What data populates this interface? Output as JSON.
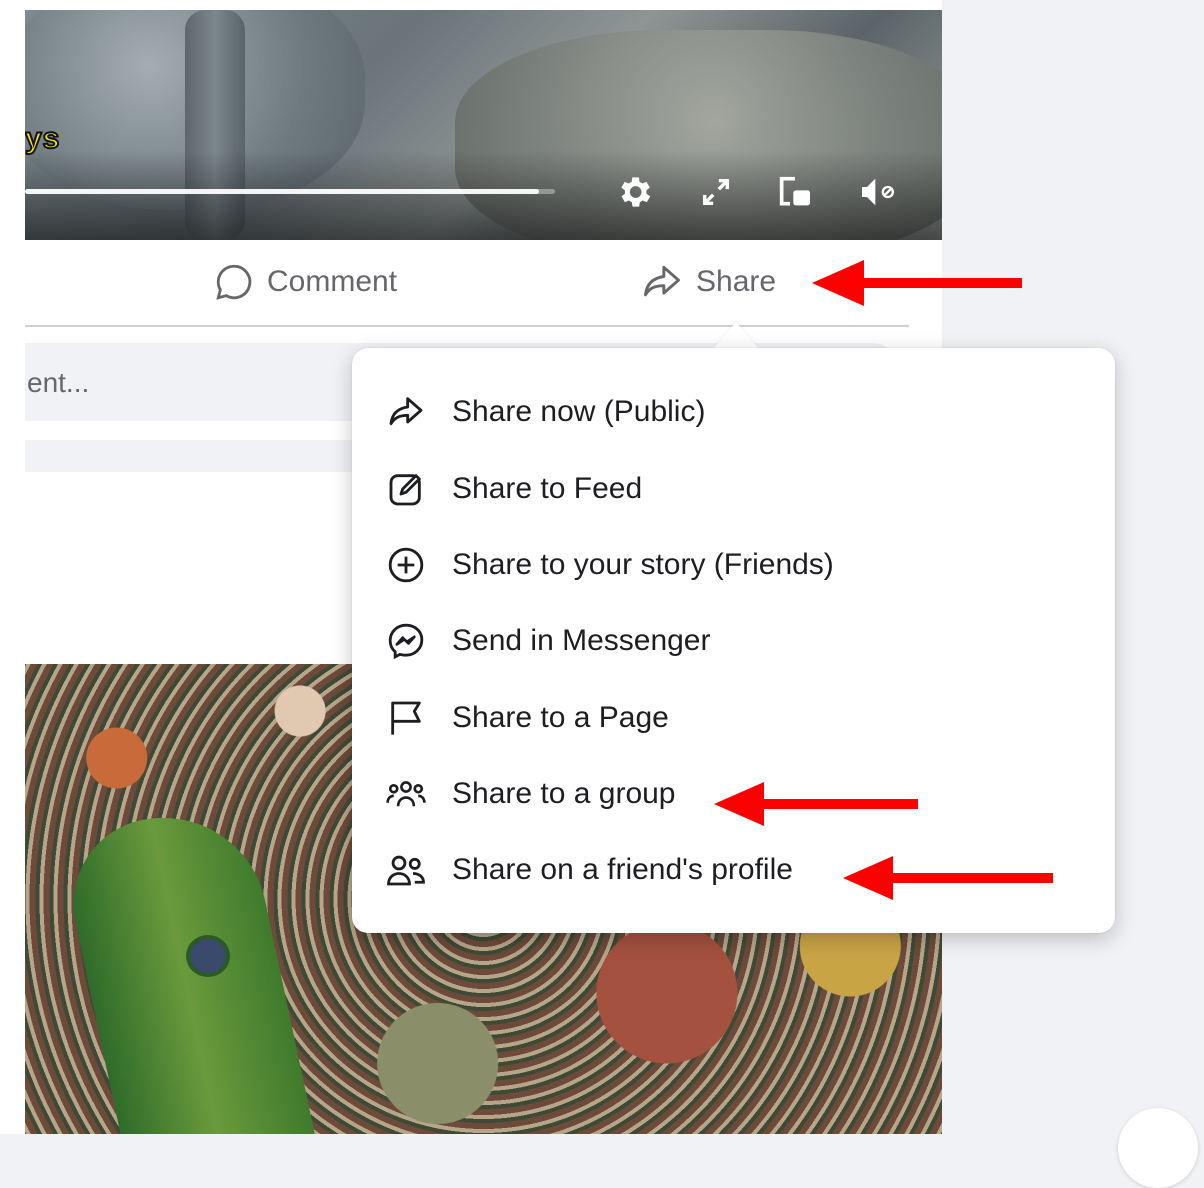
{
  "video": {
    "caption_fragment": "ys",
    "progress_fraction": 0.97,
    "controls": {
      "settings_icon": "gear-icon",
      "fullscreen_icon": "expand-icon",
      "pip_icon": "picture-in-picture-icon",
      "mute_icon": "volume-muted-icon"
    }
  },
  "actions": {
    "comment_label": "Comment",
    "share_label": "Share"
  },
  "comment_box": {
    "placeholder": "ent..."
  },
  "share_menu": {
    "items": [
      {
        "label": "Share now (Public)",
        "icon": "share-arrow-icon"
      },
      {
        "label": "Share to Feed",
        "icon": "edit-icon"
      },
      {
        "label": "Share to your story (Friends)",
        "icon": "plus-circle-icon"
      },
      {
        "label": "Send in Messenger",
        "icon": "messenger-icon"
      },
      {
        "label": "Share to a Page",
        "icon": "flag-icon"
      },
      {
        "label": "Share to a group",
        "icon": "group-icon"
      },
      {
        "label": "Share on a friend's profile",
        "icon": "friends-icon"
      }
    ]
  },
  "colors": {
    "annotation_arrow": "#ff0000",
    "menu_text": "#1c1e21",
    "muted_text": "#65676b",
    "page_background": "#f0f2f5"
  }
}
